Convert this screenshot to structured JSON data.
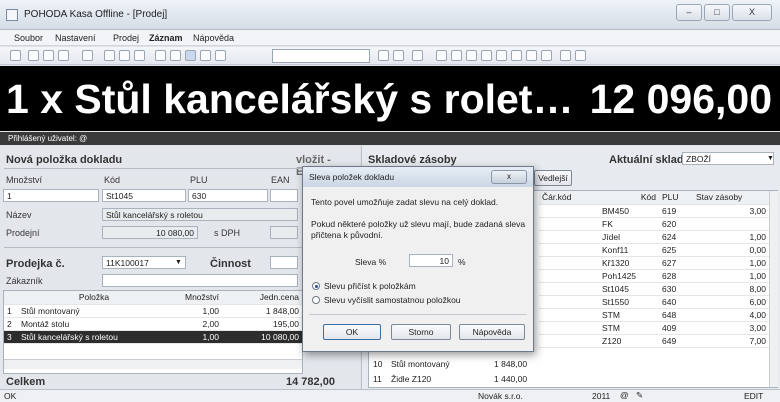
{
  "window": {
    "title": "POHODA Kasa Offline - [Prodej]",
    "minimize": "–",
    "maximize": "□",
    "close": "X"
  },
  "menu": [
    "Soubor",
    "Nastavení",
    "Prodej",
    "Záznam",
    "Nápověda"
  ],
  "display": {
    "line": "1 x  Stůl kancelářský s rolet…",
    "total": "12 096,00"
  },
  "user": {
    "label": "Přihlášený uživatel: @"
  },
  "new_item": {
    "header": "Nová položka dokladu",
    "insert_hint": "vložit - Enter",
    "qty_label": "Množství",
    "qty_value": "1",
    "code_label": "Kód",
    "code_value": "St1045",
    "plu_label": "PLU",
    "plu_value": "630",
    "ean_label": "EAN",
    "name_label": "Název",
    "name_value": "Stůl kancelářský s roletou",
    "price_label": "Prodejní",
    "price_value": "10 080,00",
    "vat_label": "s DPH"
  },
  "sale": {
    "header": "Prodejka č.",
    "number": "11K100017",
    "activity_label": "Činnost",
    "customer_label": "Zákazník",
    "columns": [
      "",
      "Položka",
      "Množství",
      "Jedn.cena"
    ],
    "rows": [
      {
        "n": "1",
        "item": "Stůl montovaný",
        "qty": "1,00",
        "price": "1 848,00"
      },
      {
        "n": "2",
        "item": "Montáž stolu",
        "qty": "2,00",
        "price": "195,00"
      },
      {
        "n": "3",
        "item": "Stůl kancelářský s roletou",
        "qty": "1,00",
        "price": "10 080,00"
      }
    ],
    "total_label": "Celkem",
    "total_value": "14 782,00"
  },
  "stock": {
    "header": "Skladové zásoby",
    "warehouse_label": "Aktuální sklad",
    "warehouse_value": "ZBOŽÍ",
    "next_button": "Vedlejší",
    "columns": [
      "Čár.kód",
      "Kód",
      "PLU",
      "Stav zásoby"
    ],
    "rows": [
      {
        "code": "BM450",
        "plu": "619",
        "stock": "3,00"
      },
      {
        "code": "FK",
        "plu": "620",
        "stock": ""
      },
      {
        "code": "Jídel",
        "plu": "624",
        "stock": "1,00"
      },
      {
        "code": "Konf11",
        "plu": "625",
        "stock": "0,00"
      },
      {
        "code": "Kř1320",
        "plu": "627",
        "stock": "1,00"
      },
      {
        "code": "Poh1425",
        "plu": "628",
        "stock": "1,00"
      },
      {
        "code": "St1045",
        "plu": "630",
        "stock": "8,00"
      },
      {
        "code": "St1550",
        "plu": "640",
        "stock": "6,00"
      },
      {
        "code": "STM",
        "plu": "648",
        "stock": "4,00"
      },
      {
        "code": "STM",
        "plu": "409",
        "stock": "3,00"
      },
      {
        "code": "Z120",
        "plu": "649",
        "stock": "7,00"
      }
    ],
    "bottom_rows": [
      {
        "n": "10",
        "name": "Stůl montovaný",
        "price": "1 848,00"
      },
      {
        "n": "11",
        "name": "Židle Z120",
        "price": "1 440,00"
      }
    ]
  },
  "dialog": {
    "title": "Sleva položek dokladu",
    "text1": "Tento povel umožňuje zadat slevu na celý doklad.",
    "text2": "Pokud některé položky už slevu mají, bude zadaná sleva přičtena k původní.",
    "discount_label": "Sleva %",
    "discount_value": "10",
    "percent": "%",
    "option1": "Slevu přičíst k položkám",
    "option2": "Slevu vyčíslit samostatnou položkou",
    "ok": "OK",
    "cancel": "Storno",
    "help": "Nápověda",
    "close": "x"
  },
  "status": {
    "left": "OK",
    "company": "Novák s.r.o.",
    "year": "2011",
    "mode": "EDIT"
  }
}
